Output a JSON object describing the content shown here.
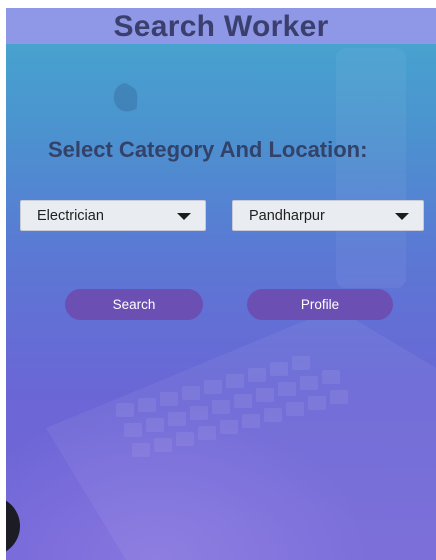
{
  "header": {
    "title": "Search Worker"
  },
  "main": {
    "prompt": "Select Category And Location:",
    "category_dropdown": {
      "selected": "Electrician",
      "icon": "caret-down-icon"
    },
    "location_dropdown": {
      "selected": "Pandharpur",
      "icon": "caret-down-icon"
    },
    "search_button": {
      "label": "Search"
    },
    "profile_button": {
      "label": "Profile"
    }
  },
  "colors": {
    "header_bg": "#8f98e6",
    "title_text": "#3b3f6e",
    "button_bg": "#6c4fb2",
    "gradient_top": "#46a8cf",
    "gradient_bottom": "#7567d8"
  }
}
